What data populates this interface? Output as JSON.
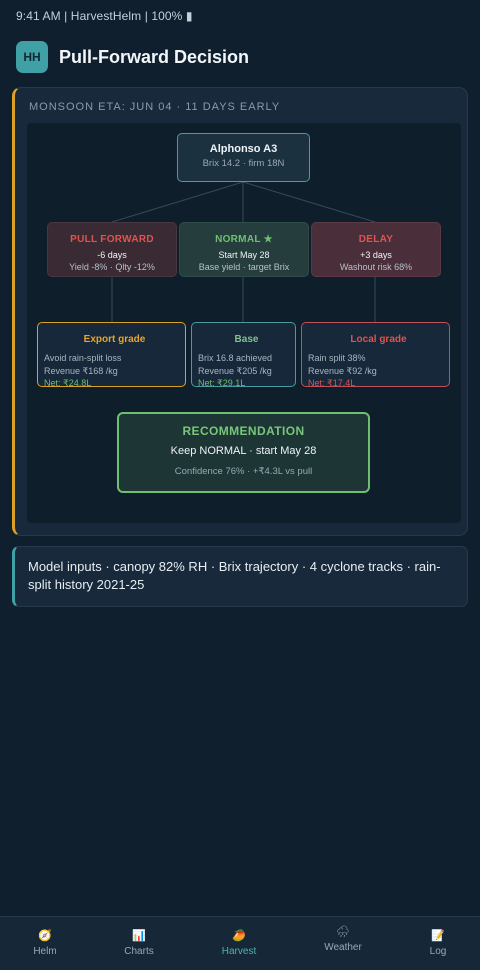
{
  "status_bar": "9:41 AM | HarvestHelm | 100% ▮",
  "header": {
    "logo": "HH",
    "title": "Pull-Forward Decision"
  },
  "card": {
    "eta_label": "MONSOON ETA: JUN 04 · 11 DAYS EARLY"
  },
  "tree": {
    "root": {
      "title": "Alphonso A3",
      "sub": "Brix 14.2 · firm 18N"
    },
    "options": [
      {
        "title": "PULL FORWARD",
        "line1": "-6 days",
        "line2": "Yield -8% · Qlty -12%"
      },
      {
        "title": "NORMAL ★",
        "line1": "Start May 28",
        "line2": "Base yield · target Brix"
      },
      {
        "title": "DELAY",
        "line1": "+3 days",
        "line2": "Washout risk 68%"
      }
    ],
    "outcomes": [
      {
        "title": "Export grade",
        "note": "Avoid rain-split loss",
        "revenue": "Revenue ₹168 /kg",
        "net": "Net: ₹24.8L"
      },
      {
        "title": "Base",
        "note": "Brix 16.8 achieved",
        "revenue": "Revenue ₹205 /kg",
        "net": "Net: ₹29.1L"
      },
      {
        "title": "Local grade",
        "note": "Rain split 38%",
        "revenue": "Revenue ₹92 /kg",
        "net": "Net: ₹17.4L"
      }
    ],
    "recommendation": {
      "title": "RECOMMENDATION",
      "main": "Keep NORMAL · start May 28",
      "sub": "Confidence 76% · +₹4.3L vs pull"
    }
  },
  "inputs_note": "Model inputs · canopy 82% RH · Brix trajectory · 4 cyclone tracks · rain-split history 2021-25",
  "nav": [
    {
      "icon": "🧭",
      "icon_name": "compass-icon",
      "label": "Helm"
    },
    {
      "icon": "📊",
      "icon_name": "bar-chart-icon",
      "label": "Charts"
    },
    {
      "icon": "🥭",
      "icon_name": "mango-icon",
      "label": "Harvest",
      "active": true
    },
    {
      "icon": "🌧",
      "icon_name": "rain-cloud-icon",
      "label": "Weather"
    },
    {
      "icon": "📝",
      "icon_name": "memo-icon",
      "label": "Log"
    }
  ],
  "colors": {
    "background": "#0f1f2d",
    "accent_teal": "#3fa0a6",
    "accent_gold": "#d9a227",
    "positive_green": "#6fbf73",
    "negative_red": "#e0534f"
  }
}
